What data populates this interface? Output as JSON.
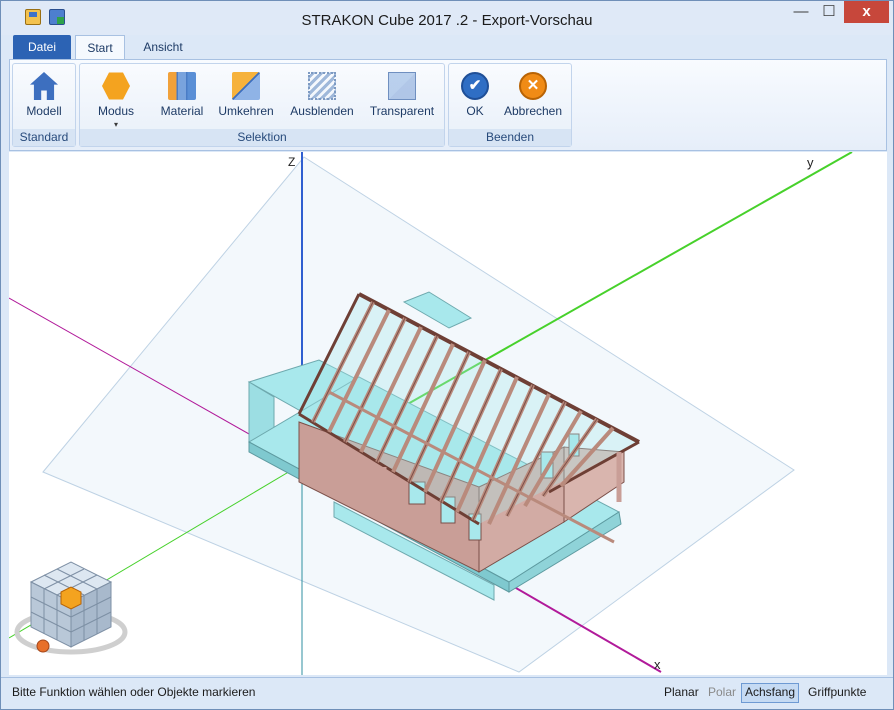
{
  "window": {
    "title": "STRAKON Cube 2017 .2 - Export-Vorschau",
    "close_glyph": "x",
    "minimize_glyph": "—",
    "maximize_glyph": "☐"
  },
  "quick_access": [
    "save-icon",
    "export-icon"
  ],
  "tabs": {
    "file": "Datei",
    "start": "Start",
    "view": "Ansicht"
  },
  "ribbon": {
    "groups": {
      "standard": "Standard",
      "selektion": "Selektion",
      "beenden": "Beenden"
    },
    "buttons": {
      "modell": "Modell",
      "modus": "Modus",
      "material": "Material",
      "umkehren": "Umkehren",
      "ausblenden": "Ausblenden",
      "transparent": "Transparent",
      "ok": "OK",
      "abbrechen": "Abbrechen"
    },
    "ok_glyph": "✔",
    "cancel_glyph": "✕",
    "dropdown_glyph": "▾"
  },
  "viewport": {
    "axes": {
      "z": "Z",
      "y": "y",
      "x": "x"
    },
    "colors": {
      "z_axis": "#2f5fd0",
      "y_axis": "#47d12b",
      "x_axis": "#b11a9a",
      "roof_wood": "#b98a7c",
      "walls": "#c99e97",
      "slab": "#a8e8ec"
    }
  },
  "status": {
    "message": "Bitte Funktion wählen oder Objekte markieren",
    "planar": "Planar",
    "polar": "Polar",
    "achsfang": "Achsfang",
    "griffpunkte": "Griffpunkte"
  }
}
